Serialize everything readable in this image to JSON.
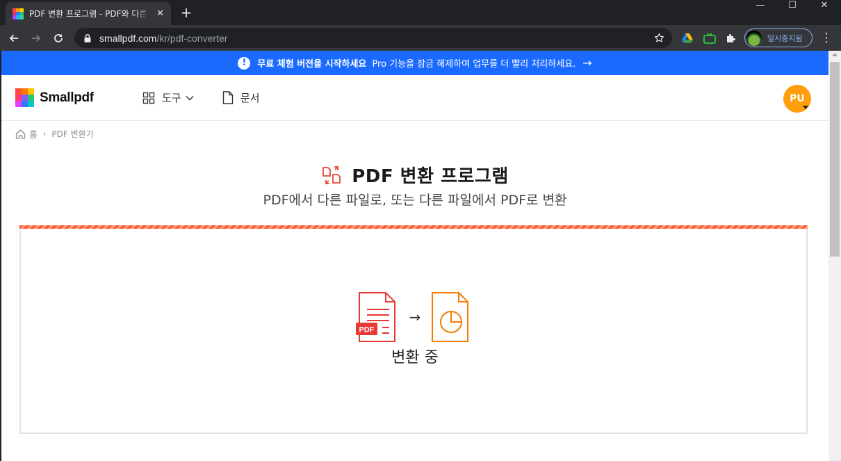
{
  "browser": {
    "tab_title": "PDF 변환 프로그램 - PDF와 다른",
    "tab_close": "✕",
    "new_tab": "+",
    "url_host": "smallpdf.com",
    "url_path": "/kr/pdf-converter",
    "profile_label": "일시중지됨",
    "window_controls": {
      "minimize": "—",
      "maximize": "☐",
      "close": "✕"
    }
  },
  "banner": {
    "bold_text": "무료 체험 버전을 시작하세요",
    "text": "Pro 기능을 잠금 해제하여 업무를 더 빨리 처리하세요.",
    "arrow": "→",
    "alert_icon": "!"
  },
  "header": {
    "logo_text": "Smallpdf",
    "nav": {
      "tools_label": "도구",
      "documents_label": "문서"
    },
    "avatar_initials": "PU"
  },
  "breadcrumb": {
    "home_label": "홈",
    "separator": "›",
    "current_label": "PDF 변환기"
  },
  "main": {
    "title": "PDF 변환 프로그램",
    "subtitle": "PDF에서 다른 파일로, 또는 다른 파일에서 PDF로 변환",
    "pdf_badge": "PDF",
    "arrow": "→",
    "status": "변환 중"
  },
  "colors": {
    "banner_blue": "#1b6aff",
    "accent_red": "#e53935",
    "accent_orange": "#f57c00",
    "avatar_orange": "#ff9d0a"
  }
}
